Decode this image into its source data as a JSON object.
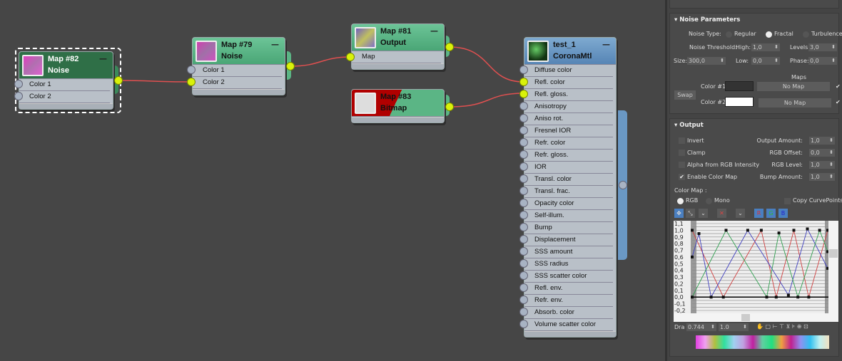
{
  "nodes": {
    "map82": {
      "name": "Map #82",
      "type": "Noise",
      "inputs": [
        "Color 1",
        "Color 2"
      ]
    },
    "map79": {
      "name": "Map #79",
      "type": "Noise",
      "inputs": [
        "Color 1",
        "Color 2"
      ]
    },
    "map81": {
      "name": "Map #81",
      "type": "Output",
      "inputs": [
        "Map"
      ]
    },
    "map83": {
      "name": "Map #83",
      "type": "Bitmap"
    },
    "material": {
      "name": "test_1",
      "type": "CoronaMtl",
      "inputs": [
        "Diffuse color",
        "Refl. color",
        "Refl. gloss.",
        "Anisotropy",
        "Aniso rot.",
        "Fresnel IOR",
        "Refr. color",
        "Refr. gloss.",
        "IOR",
        "Transl. color",
        "Transl. frac.",
        "Opacity color",
        "Self-illum.",
        "Bump",
        "Displacement",
        "SSS amount",
        "SSS radius",
        "SSS scatter color",
        "Refl. env.",
        "Refr. env.",
        "Absorb. color",
        "Volume scatter color"
      ]
    },
    "minimize": "—"
  },
  "colors": {
    "wire": "#e05050",
    "socket_connected": "#d9f20a",
    "node_green": "#5bb585",
    "material_header": "#6a98c4"
  },
  "noise": {
    "title": "Noise Parameters",
    "noise_type_label": "Noise Type:",
    "types": [
      "Regular",
      "Fractal",
      "Turbulence"
    ],
    "selected_type": "Fractal",
    "threshold_label": "Noise Threshold:",
    "high_label": "High:",
    "high": "1,0",
    "levels_label": "Levels:",
    "levels": "3,0",
    "size_label": "Size:",
    "size": "300,0",
    "low_label": "Low:",
    "low": "0,0",
    "phase_label": "Phase:",
    "phase": "0,0",
    "maps_label": "Maps",
    "swap": "Swap",
    "color1_label": "Color #1",
    "color2_label": "Color #2",
    "color1": "#333333",
    "color2": "#ffffff",
    "no_map": "No Map",
    "check": "✔"
  },
  "output": {
    "title": "Output",
    "invert": "Invert",
    "clamp": "Clamp",
    "alpha": "Alpha from RGB Intensity",
    "enable_color_map": "Enable Color Map",
    "output_amount_label": "Output Amount:",
    "output_amount": "1,0",
    "rgb_offset_label": "RGB Offset:",
    "rgb_offset": "0,0",
    "rgb_level_label": "RGB Level:",
    "rgb_level": "1,0",
    "bump_amount_label": "Bump Amount:",
    "bump_amount": "1,0",
    "color_map_label": "Color Map :",
    "rgb": "RGB",
    "mono": "Mono",
    "copy_curve": "Copy CurvePoints",
    "r": "R",
    "g": "G",
    "b": "B",
    "drag_label": "Dra",
    "drag_x": "0.744",
    "drag_y": "1.0"
  },
  "chart_data": {
    "type": "line",
    "ylim": [
      -0.2,
      1.1
    ],
    "xlim": [
      0,
      1
    ],
    "yticks": [
      "1,1",
      "1,0",
      "0,9",
      "0,8",
      "0,7",
      "0,6",
      "0,5",
      "0,4",
      "0,3",
      "0,2",
      "0,1",
      "0,0",
      "-0,1",
      "-0,2"
    ],
    "series": [
      {
        "color": "#d04040",
        "points": [
          [
            0,
            1.0
          ],
          [
            0.23,
            0
          ],
          [
            0.51,
            1.0
          ],
          [
            0.62,
            0
          ],
          [
            0.75,
            1.0
          ],
          [
            0.86,
            0
          ],
          [
            1.0,
            1.0
          ]
        ]
      },
      {
        "color": "#4040c0",
        "points": [
          [
            0,
            0.6
          ],
          [
            0.05,
            0.95
          ],
          [
            0.14,
            0
          ],
          [
            0.41,
            1.0
          ],
          [
            0.71,
            0.03
          ],
          [
            0.85,
            1.02
          ],
          [
            1.0,
            0.43
          ]
        ]
      },
      {
        "color": "#30a050",
        "points": [
          [
            0,
            0
          ],
          [
            0.25,
            1.0
          ],
          [
            0.55,
            0
          ],
          [
            0.64,
            0.96
          ],
          [
            0.78,
            0
          ],
          [
            0.94,
            1.0
          ],
          [
            1.0,
            0.68
          ]
        ]
      }
    ]
  }
}
